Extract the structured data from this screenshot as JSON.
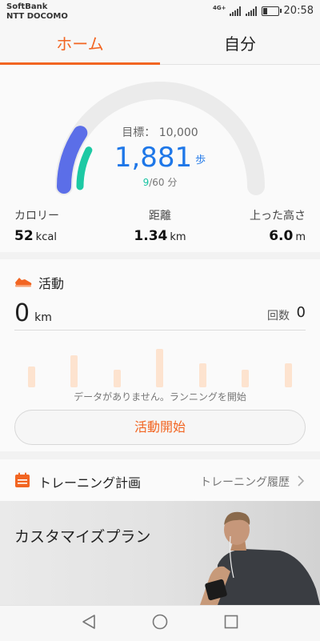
{
  "status_bar": {
    "carrier_line1": "SoftBank",
    "carrier_line2": "NTT DOCOMO",
    "network": "4G+",
    "time": "20:58"
  },
  "tabs": [
    {
      "label": "ホーム",
      "active": true
    },
    {
      "label": "自分",
      "active": false
    }
  ],
  "summary": {
    "goal_label": "目標： 10,000",
    "steps": "1,881",
    "steps_unit": "歩",
    "active_minutes": "9",
    "minutes_goal": "/60 分",
    "steps_progress": 0.1881,
    "minutes_progress": 0.15,
    "stats": {
      "calories": {
        "label": "カロリー",
        "value": "52",
        "unit": "kcal"
      },
      "distance": {
        "label": "距離",
        "value": "1.34",
        "unit": "km"
      },
      "climb": {
        "label": "上った高さ",
        "value": "6.0",
        "unit": "m"
      }
    }
  },
  "activity": {
    "title": "活動",
    "distance_value": "0",
    "distance_unit": "km",
    "count_label": "回数",
    "count_value": "0",
    "empty_message": "データがありません。ランニングを開始",
    "start_button": "活動開始"
  },
  "training": {
    "title": "トレーニング計画",
    "history_link": "トレーニング履歴"
  },
  "banner": {
    "title": "カスタマイズプラン"
  },
  "colors": {
    "accent": "#f26522",
    "steps_blue": "#1e77e8",
    "steps_arc": "#5b6ee8",
    "minutes_arc": "#1dc9a4"
  }
}
